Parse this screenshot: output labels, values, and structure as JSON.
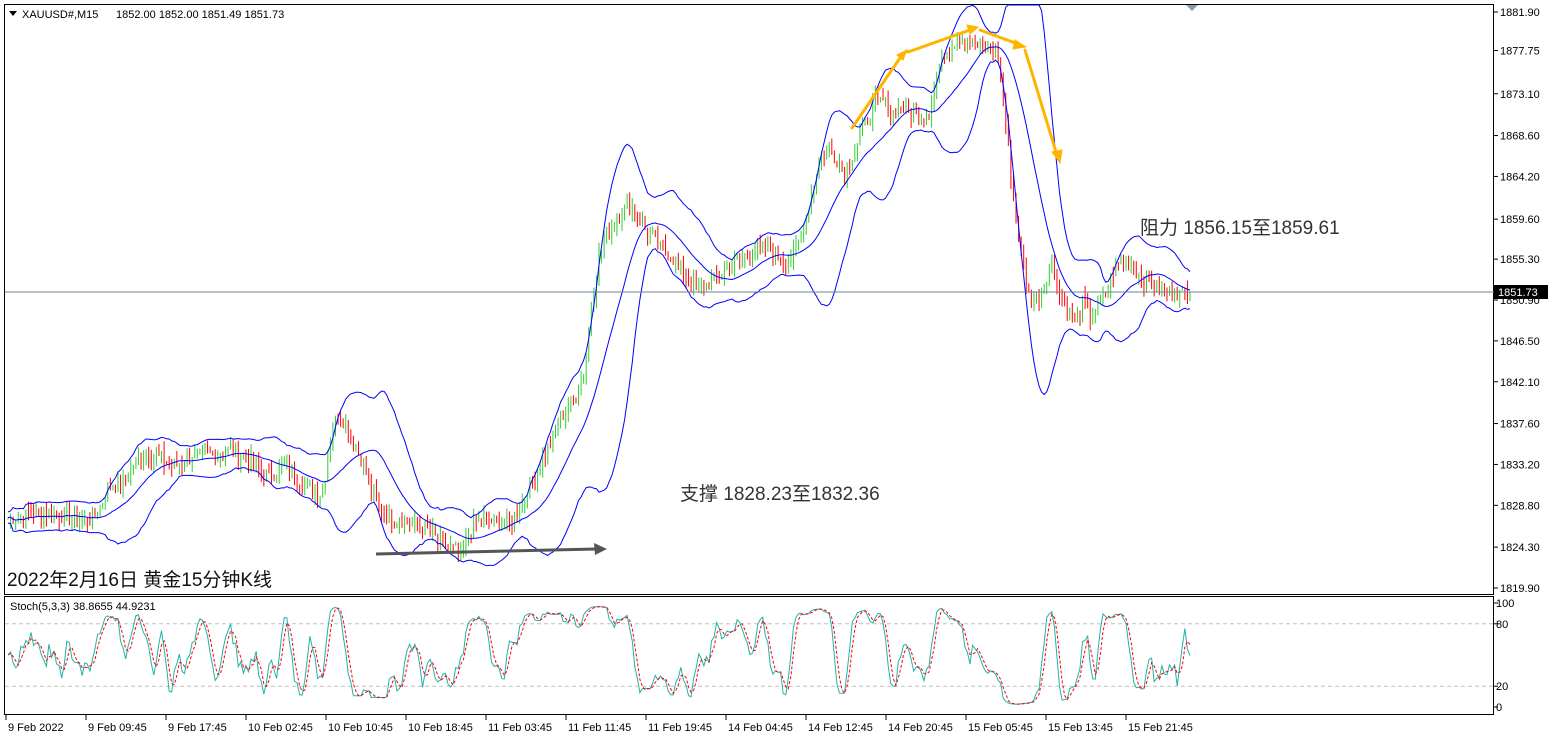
{
  "header": {
    "symbol": "XAUUSD#,M15",
    "ohlc": "1852.00 1852.00 1851.49 1851.73"
  },
  "annotations": {
    "resistance": "阻力 1856.15至1859.61",
    "support": "支撑 1828.23至1832.36",
    "caption": "2022年2月16日 黄金15分钟K线"
  },
  "price_axis": {
    "ticks": [
      "1881.90",
      "1877.75",
      "1873.10",
      "1868.60",
      "1864.20",
      "1859.60",
      "1855.30",
      "1850.90",
      "1846.50",
      "1842.10",
      "1837.60",
      "1833.20",
      "1828.80",
      "1824.30",
      "1819.90"
    ],
    "current_price_label": "1851.73"
  },
  "time_axis": {
    "ticks": [
      "9 Feb 2022",
      "9 Feb 09:45",
      "9 Feb 17:45",
      "10 Feb 02:45",
      "10 Feb 10:45",
      "10 Feb 18:45",
      "11 Feb 03:45",
      "11 Feb 11:45",
      "11 Feb 19:45",
      "14 Feb 04:45",
      "14 Feb 12:45",
      "14 Feb 20:45",
      "15 Feb 05:45",
      "15 Feb 13:45",
      "15 Feb 21:45"
    ]
  },
  "stoch": {
    "label": "Stoch(5,3,3) 38.8655 44.9231",
    "ticks": [
      "100",
      "80",
      "20",
      "0"
    ],
    "levels": [
      80,
      20
    ],
    "main_color": "#20b2aa",
    "signal_color": "#ff0000"
  },
  "colors": {
    "bull": "#32cd32",
    "bear": "#ff0000",
    "bands": "#0000ff",
    "arrows_trend": "#ffb400",
    "arrow_support": "#555555",
    "price_line": "#708090"
  },
  "chart_data": {
    "type": "candlestick",
    "indicator": "Bollinger Bands",
    "ylim": [
      1819.9,
      1881.9
    ],
    "close_path": [
      1827.5,
      1827.4,
      1827.6,
      1828.0,
      1827.8,
      1828.0,
      1827.7,
      1827.6,
      1827.5,
      1827.3,
      1827.2,
      1827.3,
      1828.5,
      1830.5,
      1831.5,
      1831.0,
      1832.5,
      1834.0,
      1834.5,
      1834.0,
      1833.8,
      1833.0,
      1833.2,
      1833.5,
      1834.2,
      1834.0,
      1834.4,
      1834.2,
      1834.5,
      1834.6,
      1834.2,
      1834.0,
      1833.5,
      1832.5,
      1832.0,
      1832.5,
      1833.0,
      1832.0,
      1831.5,
      1830.5,
      1830.5,
      1830.0,
      1836.0,
      1838.8,
      1837.5,
      1835.5,
      1834.0,
      1831.5,
      1829.0,
      1828.0,
      1827.5,
      1827.2,
      1827.0,
      1826.8,
      1826.5,
      1826.0,
      1825.0,
      1824.5,
      1824.0,
      1823.5,
      1825.5,
      1827.0,
      1827.5,
      1827.2,
      1826.8,
      1826.5,
      1827.5,
      1829.0,
      1831.0,
      1832.5,
      1834.5,
      1836.0,
      1838.0,
      1839.5,
      1840.5,
      1843.0,
      1850.0,
      1855.5,
      1858.0,
      1859.0,
      1860.5,
      1861.0,
      1860.0,
      1858.5,
      1857.5,
      1856.5,
      1856.0,
      1855.0,
      1853.8,
      1852.5,
      1852.0,
      1852.5,
      1853.0,
      1853.8,
      1854.5,
      1855.0,
      1855.2,
      1856.0,
      1856.5,
      1856.3,
      1856.0,
      1855.0,
      1855.5,
      1857.0,
      1860.0,
      1863.5,
      1866.5,
      1867.5,
      1866.0,
      1864.5,
      1866.5,
      1868.5,
      1870.5,
      1872.0,
      1872.5,
      1871.0,
      1871.5,
      1871.3,
      1871.0,
      1870.8,
      1871.0,
      1875.0,
      1877.5,
      1878.5,
      1879.0,
      1878.5,
      1878.5,
      1878.0,
      1878.0,
      1877.0,
      1870.0,
      1862.0,
      1856.0,
      1851.5,
      1850.5,
      1852.5,
      1855.0,
      1851.5,
      1850.0,
      1848.5,
      1850.5,
      1849.0,
      1850.0,
      1851.5,
      1854.0,
      1855.0,
      1855.5,
      1854.0,
      1853.0,
      1852.5,
      1852.0,
      1851.5,
      1851.8,
      1851.5,
      1851.73
    ]
  }
}
